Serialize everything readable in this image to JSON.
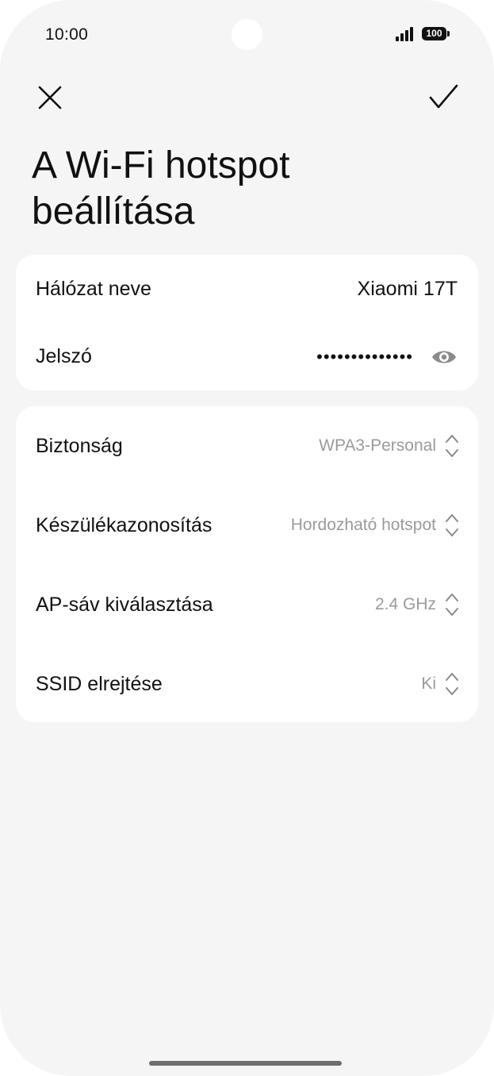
{
  "status_bar": {
    "time": "10:00",
    "battery": "100"
  },
  "toolbar": {
    "close_icon": "close-icon",
    "confirm_icon": "checkmark-icon"
  },
  "title": "A Wi-Fi hotspot beállítása",
  "network_card": {
    "name_label": "Hálózat neve",
    "name_value": "Xiaomi 17T",
    "password_label": "Jelszó",
    "password_value": "••••••••••••••",
    "password_toggle_icon": "eye-icon"
  },
  "settings_card": {
    "items": [
      {
        "label": "Biztonság",
        "value": "WPA3-Personal"
      },
      {
        "label": "Készülékazonosítás",
        "value": "Hordozható hotspot"
      },
      {
        "label": "AP-sáv kiválasztása",
        "value": "2.4 GHz"
      },
      {
        "label": "SSID elrejtése",
        "value": "Ki"
      }
    ]
  },
  "colors": {
    "background": "#f5f5f5",
    "card": "#ffffff",
    "text_primary": "#111111",
    "text_secondary": "#9a9a9a"
  }
}
